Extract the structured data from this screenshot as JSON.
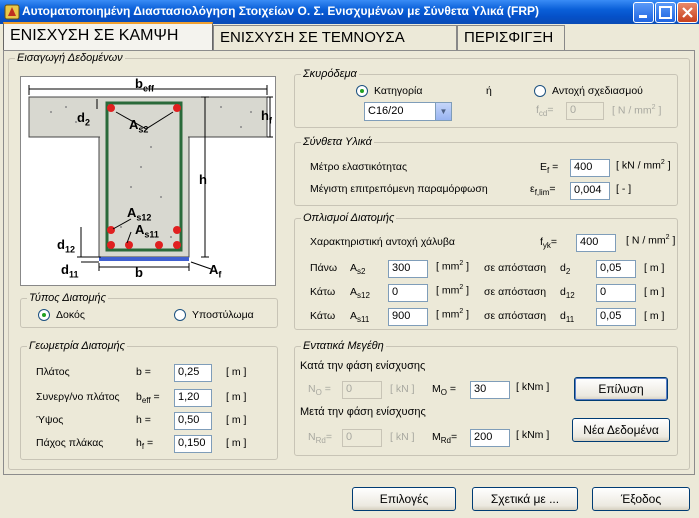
{
  "window": {
    "title": "Αυτοματοποιημένη Διαστασιολόγηση Στοιχείων Ο. Σ. Ενισχυμένων με Σύνθετα Υλικά  (FRP)"
  },
  "tabs": [
    "ΕΝΙΣΧΥΣΗ ΣΕ ΚΑΜΨΗ",
    "ΕΝΙΣΧΥΣΗ ΣΕ ΤΕΜΝΟΥΣΑ",
    "ΠΕΡΙΣΦΙΓΞΗ"
  ],
  "input_group": {
    "legend": "Εισαγωγή Δεδομένων"
  },
  "diagram": {
    "beff": "b",
    "beff_sub": "eff",
    "d2": "d",
    "d2_sub": "2",
    "hf": "h",
    "hf_sub": "f",
    "As2": "A",
    "As2_sub": "s2",
    "h": "h",
    "As12": "A",
    "As12_sub": "s12",
    "As11": "A",
    "As11_sub": "s11",
    "d12": "d",
    "d12_sub": "12",
    "d11": "d",
    "d11_sub": "11",
    "b": "b",
    "Af": "A",
    "Af_sub": "f"
  },
  "section_type": {
    "legend": "Τύπος Διατομής",
    "beam": "Δοκός",
    "column": "Υποστύλωμα"
  },
  "geometry": {
    "legend": "Γεωμετρία Διατομής",
    "rows": [
      {
        "label": "Πλάτος",
        "sym": "b",
        "sub": "",
        "value": "0,25",
        "unit": "[ m ]"
      },
      {
        "label": "Συνεργ/νο πλάτος",
        "sym": "b",
        "sub": "eff",
        "value": "1,20",
        "unit": "[ m ]"
      },
      {
        "label": "Ύψος",
        "sym": "h",
        "sub": "",
        "value": "0,50",
        "unit": "[ m ]"
      },
      {
        "label": "Πάχος πλάκας",
        "sym": "h",
        "sub": "f",
        "value": "0,150",
        "unit": "[ m ]"
      }
    ]
  },
  "concrete": {
    "legend": "Σκυρόδεμα",
    "category": "Κατηγορία",
    "or": "ή",
    "design": "Αντοχή σχεδιασμού",
    "grade": "C16/20",
    "fcd_sym": "f",
    "fcd_sub": "cd",
    "fcd_eq": "=",
    "fcd_value": "0",
    "fcd_unit": "[ N / mm",
    "fcd_unit_sup": "2",
    "fcd_unit_end": " ]"
  },
  "composite": {
    "legend": "Σύνθετα Υλικά",
    "modulus": "Μέτρο ελαστικότητας",
    "E_sym": "E",
    "E_sub": "f",
    "E_eq": " =",
    "E_value": "400",
    "E_unit": "[ kN / mm",
    "E_unit_sup": "2",
    "E_unit_end": " ]",
    "strain": "Μέγιστη επιτρεπόμενη παραμόρφωση",
    "eps_sym": "ε",
    "eps_sub": "f,lim",
    "eps_eq": "=",
    "eps_value": "0,004",
    "eps_unit": "[  -  ]"
  },
  "reinforcement": {
    "legend": "Οπλισμοί Διατομής",
    "fyk_label": "Χαρακτηριστική αντοχή χάλυβα",
    "fyk_sym": "f",
    "fyk_sub": "yk",
    "fyk_eq": "=",
    "fyk_value": "400",
    "fyk_unit": "[ N / mm",
    "fyk_unit_sup": "2",
    "fyk_unit_end": " ]",
    "rows": [
      {
        "pos": "Πάνω",
        "sym": "A",
        "sub": "s2",
        "value": "300",
        "unit": "[ mm",
        "unit_sup": "2",
        "unit_end": " ]",
        "dist": "σε απόσταση",
        "dsym": "d",
        "dsub": "2",
        "dvalue": "0,05",
        "dunit": "[ m ]"
      },
      {
        "pos": "Κάτω",
        "sym": "A",
        "sub": "s12",
        "value": "0",
        "unit": "[ mm",
        "unit_sup": "2",
        "unit_end": " ]",
        "dist": "σε απόσταση",
        "dsym": "d",
        "dsub": "12",
        "dvalue": "0",
        "dunit": "[ m ]"
      },
      {
        "pos": "Κάτω",
        "sym": "A",
        "sub": "s11",
        "value": "900",
        "unit": "[ mm",
        "unit_sup": "2",
        "unit_end": " ]",
        "dist": "σε απόσταση",
        "dsym": "d",
        "dsub": "11",
        "dvalue": "0,05",
        "dunit": "[ m ]"
      }
    ]
  },
  "forces": {
    "legend": "Εντατικά Μεγέθη",
    "before": "Κατά την φάση ενίσχυσης",
    "N0_sym": "N",
    "N0_sub": "O",
    "N0_eq": " =",
    "N0_value": "0",
    "N0_unit": "[ kN ]",
    "M0_sym": "M",
    "M0_sub": "O",
    "M0_eq": " =",
    "M0_value": "30",
    "M0_unit": "[ kNm ]",
    "after": "Μετά την φάση ενίσχυσης",
    "NRd_sym": "N",
    "NRd_sub": "Rd",
    "NRd_eq": "=",
    "NRd_value": "0",
    "NRd_unit": "[ kN ]",
    "MRd_sym": "M",
    "MRd_sub": "Rd",
    "MRd_eq": "=",
    "MRd_value": "200",
    "MRd_unit": "[ kNm ]",
    "solve": "Επίλυση",
    "new_data": "Νέα Δεδομένα"
  },
  "bottom": {
    "options": "Επιλογές",
    "about": "Σχετικά με ...",
    "exit": "Έξοδος"
  }
}
